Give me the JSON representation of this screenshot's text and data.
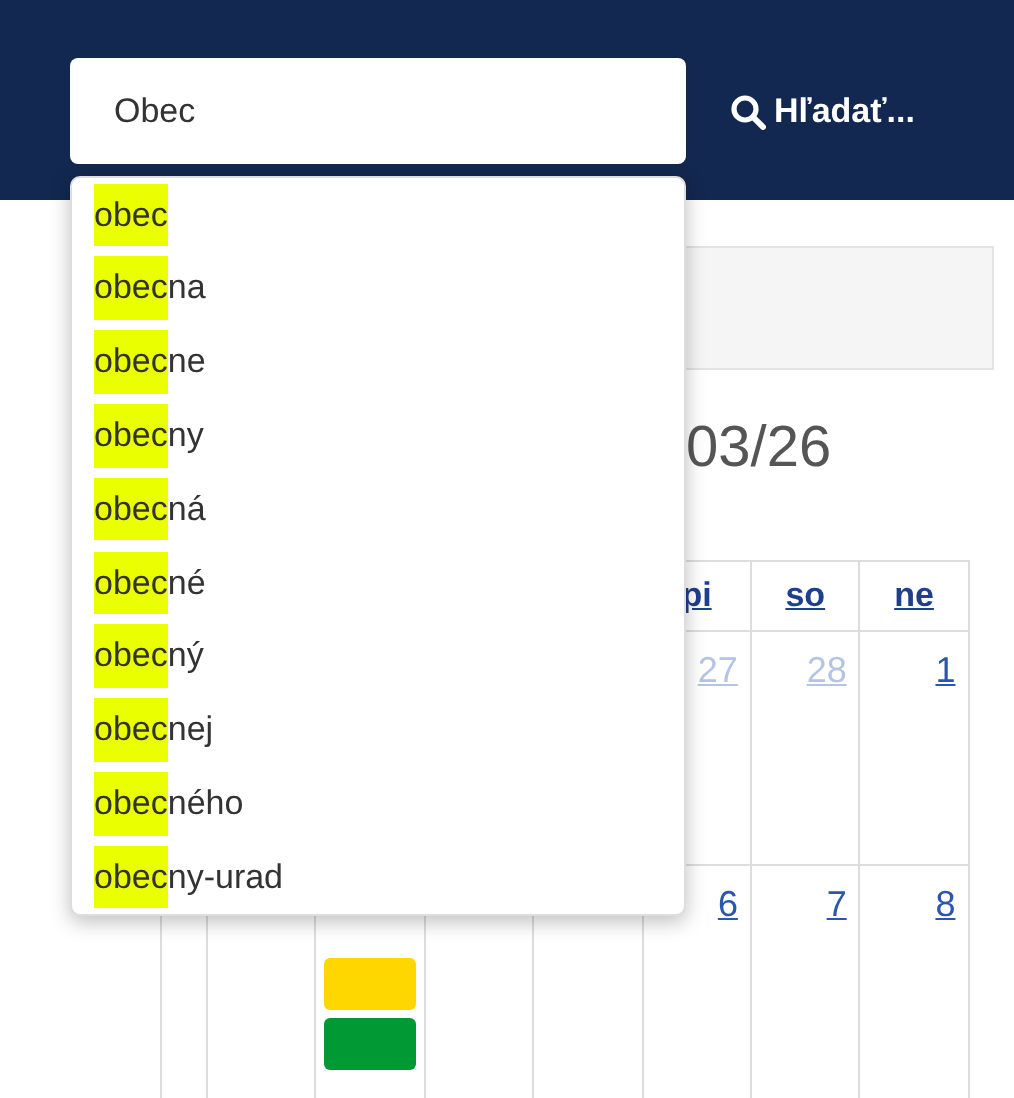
{
  "search": {
    "value": "Obec",
    "button_label": "Hľadať...",
    "suggestions": [
      {
        "match": "obec"
      },
      {
        "match": "obec",
        "rest": "na"
      },
      {
        "match": "obec",
        "rest": "ne"
      },
      {
        "match": "obec",
        "rest": "ny"
      },
      {
        "match": "obec",
        "rest": "ná"
      },
      {
        "match": "obec",
        "rest": "né"
      },
      {
        "match": "obec",
        "rest": "ný"
      },
      {
        "match": "obec",
        "rest": "nej"
      },
      {
        "match": "obec",
        "rest": "ného"
      },
      {
        "match": "obec",
        "rest": "ny-urad"
      }
    ]
  },
  "calendar": {
    "title": "03/26",
    "weekdays": [
      {
        "label": "pi"
      },
      {
        "label": "so"
      },
      {
        "label": "ne"
      }
    ],
    "weeks": [
      {
        "days": [
          {
            "label": "27",
            "other_month": true
          },
          {
            "label": "28",
            "other_month": true
          },
          {
            "label": "1",
            "other_month": false
          }
        ]
      },
      {
        "days": [
          {
            "label": "6",
            "other_month": false
          },
          {
            "label": "7",
            "other_month": false
          },
          {
            "label": "8",
            "other_month": false
          }
        ],
        "tuesday_events": [
          {
            "color": "#ffd700"
          },
          {
            "color": "#009933"
          }
        ]
      }
    ]
  }
}
